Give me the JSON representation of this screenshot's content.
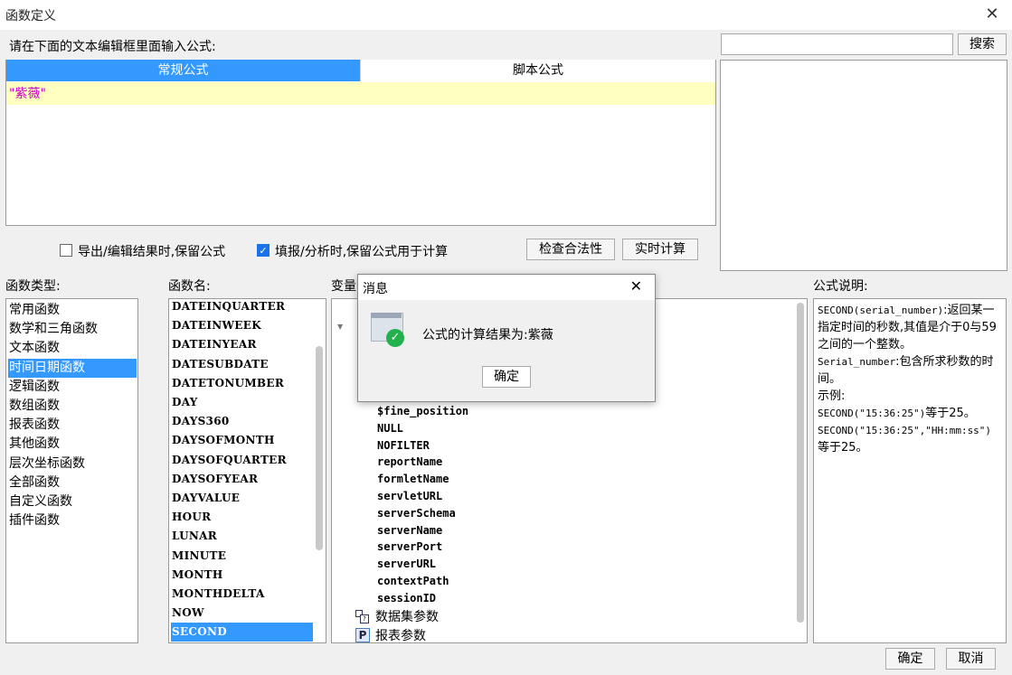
{
  "window": {
    "title": "函数定义"
  },
  "editor": {
    "prompt": "请在下面的文本编辑框里面输入公式:",
    "tabs": [
      "常规公式",
      "脚本公式"
    ],
    "formula": "\"紫薇\""
  },
  "search": {
    "input_value": "",
    "button": "搜索"
  },
  "options": {
    "keep_formula_export": "导出/编辑结果时,保留公式",
    "keep_formula_fill": "填报/分析时,保留公式用于计算",
    "check_button": "检查合法性",
    "realtime_button": "实时计算"
  },
  "function_types": {
    "label": "函数类型:",
    "items": [
      "常用函数",
      "数学和三角函数",
      "文本函数",
      "时间日期函数",
      "逻辑函数",
      "数组函数",
      "报表函数",
      "其他函数",
      "层次坐标函数",
      "全部函数",
      "自定义函数",
      "插件函数"
    ],
    "selected": "时间日期函数"
  },
  "function_names": {
    "label": "函数名:",
    "items": [
      "DATEINQUARTER",
      "DATEINWEEK",
      "DATEINYEAR",
      "DATESUBDATE",
      "DATETONUMBER",
      "DAY",
      "DAYS360",
      "DAYSOFMONTH",
      "DAYSOFQUARTER",
      "DAYSOFYEAR",
      "DAYVALUE",
      "HOUR",
      "LUNAR",
      "MINUTE",
      "MONTH",
      "MONTHDELTA",
      "NOW",
      "SECOND"
    ],
    "selected": "SECOND"
  },
  "variables": {
    "label": "变量",
    "items": [
      "$fine_position",
      "NULL",
      "NOFILTER",
      "reportName",
      "formletName",
      "servletURL",
      "serverSchema",
      "serverName",
      "serverPort",
      "serverURL",
      "contextPath",
      "sessionID"
    ],
    "groups": [
      "数据集参数",
      "报表参数"
    ]
  },
  "description": {
    "label": "公式说明:",
    "lines": [
      {
        "mono": "SECOND(serial_number)",
        "text": ":返回某一指定时间的秒数,其值是介于0与59之间的一个整数。"
      },
      {
        "mono": "Serial_number",
        "text": ":包含所求秒数的时间。"
      },
      {
        "mono": "",
        "text": "示例:"
      },
      {
        "mono": "SECOND(\"15:36:25\")",
        "text": "等于25。"
      },
      {
        "mono": "SECOND(\"15:36:25\",\"HH:mm:ss\")",
        "text": "等于25。"
      }
    ]
  },
  "dialog": {
    "title": "消息",
    "message": "公式的计算结果为:紫薇",
    "ok": "确定"
  },
  "footer": {
    "ok": "确定",
    "cancel": "取消"
  },
  "colors": {
    "accent": "#3399ff",
    "formula_bg": "#ffffc0",
    "formula_text": "#cc00cc"
  }
}
